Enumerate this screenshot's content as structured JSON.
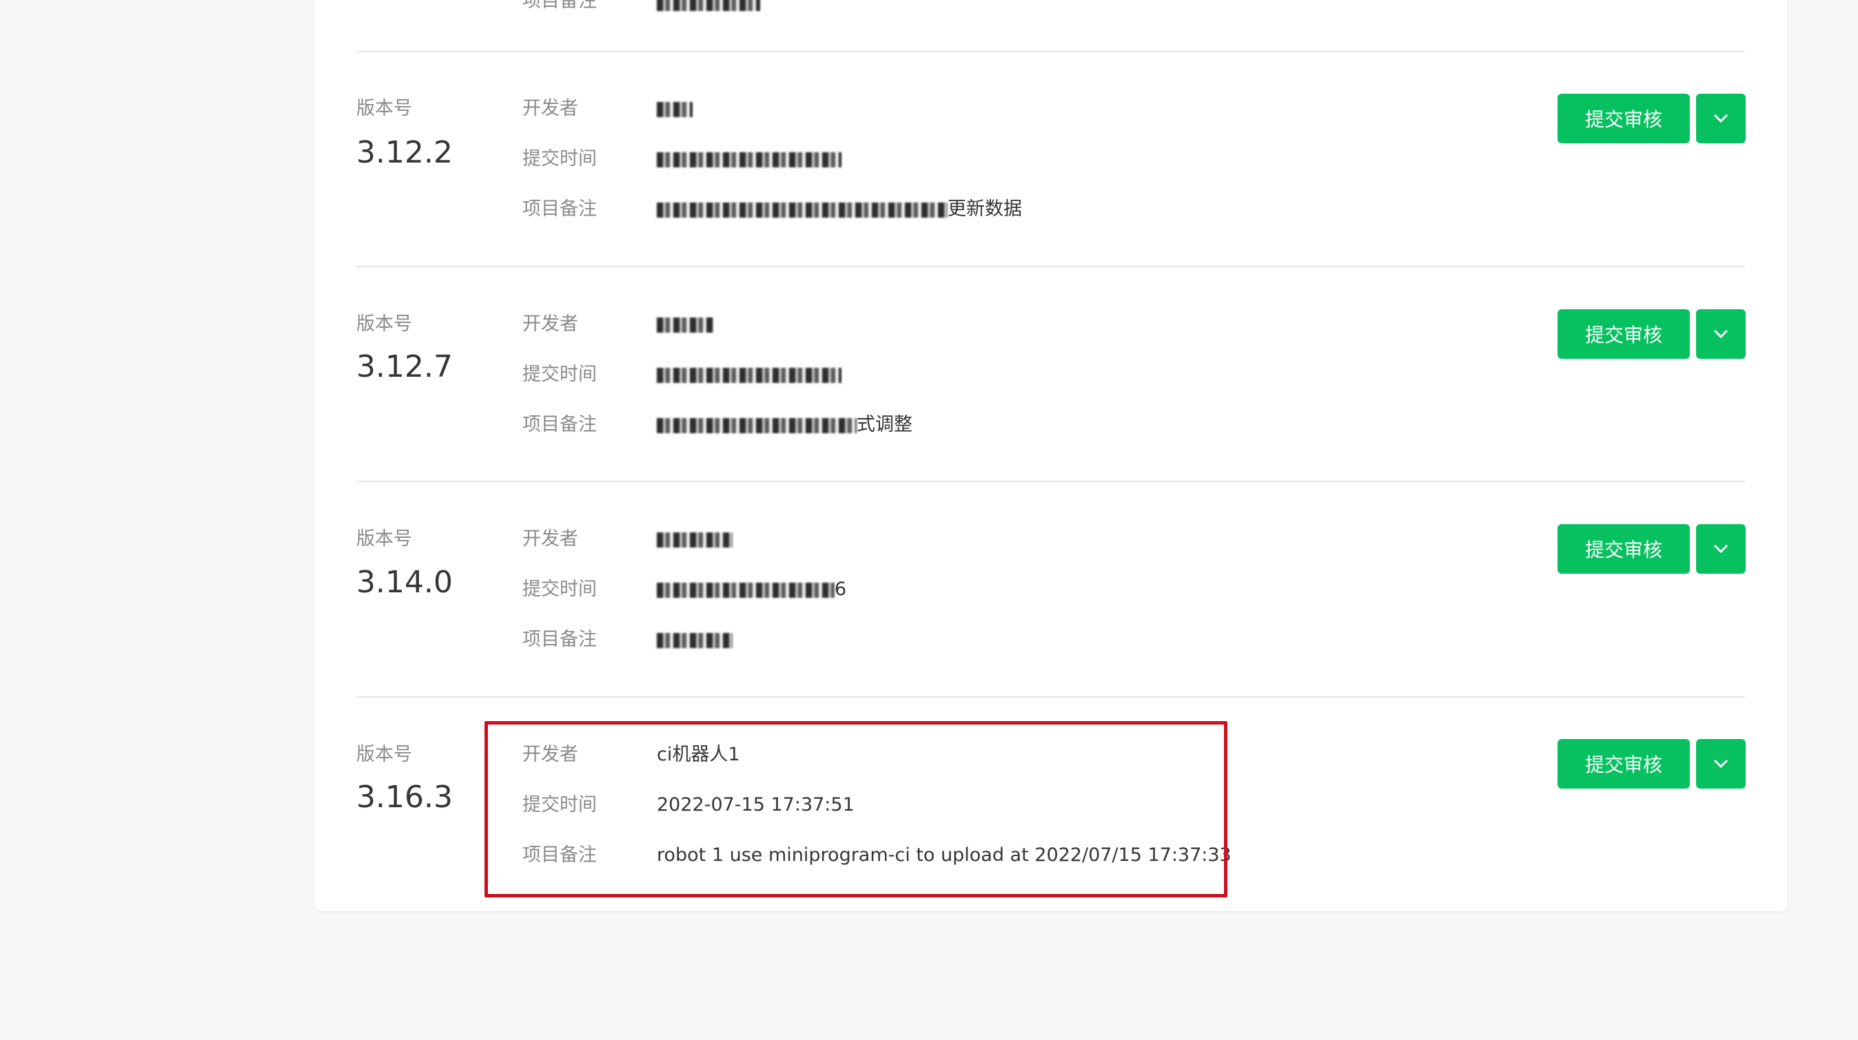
{
  "labels": {
    "version": "版本号",
    "developer": "开发者",
    "submit_time": "提交时间",
    "remark": "项目备注",
    "submit_button": "提交审核"
  },
  "top_partial": {
    "remark_label": "项目备注"
  },
  "versions": [
    {
      "version": "3.12.2",
      "developer": "",
      "submit_time": "",
      "remark": "更新数据"
    },
    {
      "version": "3.12.7",
      "developer": "",
      "submit_time": "",
      "remark": "式调整"
    },
    {
      "version": "3.14.0",
      "developer": "",
      "submit_time": "6",
      "remark": ""
    },
    {
      "version": "3.16.3",
      "developer": "ci机器人1",
      "submit_time": "2022-07-15 17:37:51",
      "remark": "robot 1 use miniprogram-ci to upload at 2022/07/15 17:37:33"
    }
  ],
  "colors": {
    "primary": "#07c160",
    "highlight": "#c8101e"
  },
  "icons": {
    "more": "chevron-down-icon"
  }
}
